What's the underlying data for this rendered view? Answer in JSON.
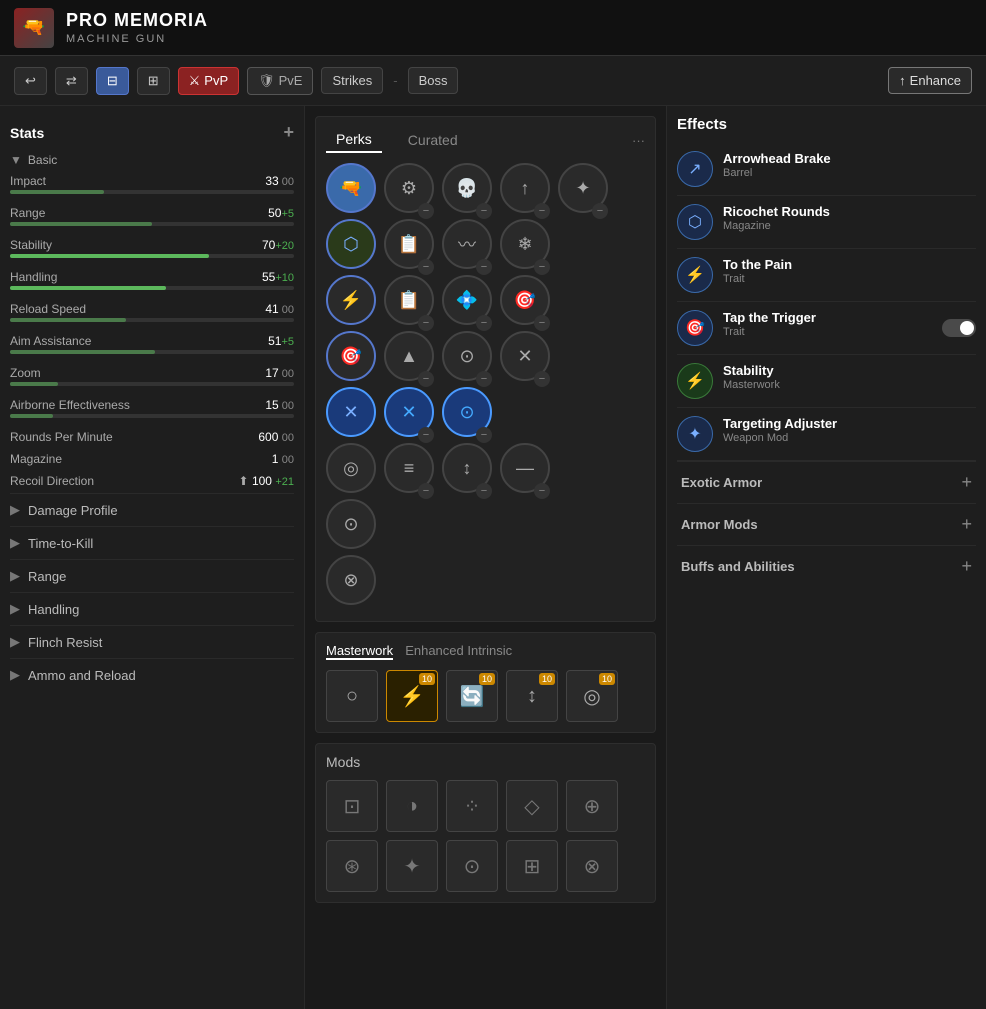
{
  "header": {
    "title": "PRO MEMORIA",
    "subtitle": "MACHINE GUN",
    "icon_char": "🔫"
  },
  "toolbar": {
    "undo_label": "↩",
    "shuffle_label": "⇄",
    "pvp_label": "PvP",
    "pve_label": "PvE",
    "strikes_label": "Strikes",
    "dash": "-",
    "boss_label": "Boss",
    "enhance_label": "Enhance",
    "pvp_icon": "⚔",
    "pve_icon": "🛡",
    "enhance_icon": "↑"
  },
  "stats": {
    "title": "Stats",
    "basic_label": "Basic",
    "items": [
      {
        "name": "Impact",
        "value": "33",
        "bonus": "",
        "bonus_type": "",
        "pct": 33
      },
      {
        "name": "Range",
        "value": "50",
        "bonus": "+5",
        "bonus_type": "pos",
        "pct": 50
      },
      {
        "name": "Stability",
        "value": "70",
        "bonus": "+20",
        "bonus_type": "pos",
        "pct": 70
      },
      {
        "name": "Handling",
        "value": "55",
        "bonus": "+10",
        "bonus_type": "pos",
        "pct": 55
      },
      {
        "name": "Reload Speed",
        "value": "41",
        "bonus": "",
        "bonus_type": "",
        "pct": 41
      },
      {
        "name": "Aim Assistance",
        "value": "51",
        "bonus": "+5",
        "bonus_type": "pos",
        "pct": 51
      },
      {
        "name": "Zoom",
        "value": "17",
        "bonus": "",
        "bonus_type": "",
        "pct": 17
      },
      {
        "name": "Airborne Effectiveness",
        "value": "15",
        "bonus": "",
        "bonus_type": "",
        "pct": 15
      }
    ],
    "rounds_per_minute": {
      "name": "Rounds Per Minute",
      "value": "600",
      "bonus": ""
    },
    "magazine": {
      "name": "Magazine",
      "value": "1",
      "bonus": ""
    },
    "recoil_direction": {
      "name": "Recoil Direction",
      "value": "100",
      "bonus": "+21",
      "bonus_type": "pos"
    }
  },
  "collapsible_sections": [
    {
      "id": "damage-profile",
      "label": "Damage Profile"
    },
    {
      "id": "time-to-kill",
      "label": "Time-to-Kill"
    },
    {
      "id": "range",
      "label": "Range"
    },
    {
      "id": "handling",
      "label": "Handling"
    },
    {
      "id": "flinch-resist",
      "label": "Flinch Resist"
    },
    {
      "id": "ammo-and-reload",
      "label": "Ammo and Reload"
    }
  ],
  "perks": {
    "tabs": [
      "Perks",
      "Curated"
    ],
    "active_tab": "Perks",
    "perk_rows": [
      {
        "left_icon": "🔵",
        "left_active": true,
        "options": [
          {
            "icon": "⚙",
            "active": false
          },
          {
            "icon": "💀",
            "active": false
          },
          {
            "icon": "↑",
            "active": false
          },
          {
            "icon": "✦",
            "active": false
          }
        ]
      },
      {
        "left_icon": "🔵",
        "left_active": true,
        "options": [
          {
            "icon": "📄",
            "active": false
          },
          {
            "icon": "〰",
            "active": false
          },
          {
            "icon": "❄",
            "active": false
          }
        ]
      },
      {
        "left_icon": "🔵",
        "left_active": true,
        "options": [
          {
            "icon": "📋",
            "active": false
          },
          {
            "icon": "💠",
            "active": false
          },
          {
            "icon": "🎯",
            "active": false
          }
        ]
      },
      {
        "left_icon": "🔵",
        "left_active": true,
        "options": [
          {
            "icon": "▲",
            "active": false
          },
          {
            "icon": "⊙",
            "active": false
          },
          {
            "icon": "✕",
            "active": false
          }
        ]
      },
      {
        "left_icon": "💠",
        "left_active": true,
        "options": [
          {
            "icon": "✕",
            "active": false
          },
          {
            "icon": "⊙",
            "active": false
          }
        ]
      },
      {
        "left_icon": "🔵",
        "left_active": false,
        "options": [
          {
            "icon": "≡",
            "active": false
          },
          {
            "icon": "↕",
            "active": false
          },
          {
            "icon": "—",
            "active": false
          }
        ]
      },
      {
        "left_icon": "🔵",
        "left_active": false,
        "options": []
      },
      {
        "left_icon": "🔵",
        "left_active": false,
        "options": []
      }
    ]
  },
  "masterwork": {
    "tabs": [
      "Masterwork",
      "Enhanced Intrinsic"
    ],
    "active_tab": "Masterwork",
    "icons": [
      {
        "icon": "○",
        "active": false,
        "badge": ""
      },
      {
        "icon": "⚡",
        "active": true,
        "badge": "10"
      },
      {
        "icon": "🔄",
        "active": false,
        "badge": "10"
      },
      {
        "icon": "↕",
        "active": false,
        "badge": "10"
      },
      {
        "icon": "◎",
        "active": false,
        "badge": "10"
      }
    ]
  },
  "mods": {
    "title": "Mods",
    "slots_row1": [
      {
        "icon": "⊡",
        "active": false
      },
      {
        "icon": "◑",
        "active": false
      },
      {
        "icon": "⁘",
        "active": false
      },
      {
        "icon": "◇",
        "active": false
      },
      {
        "icon": "⊕",
        "active": false
      }
    ],
    "slots_row2": [
      {
        "icon": "⊛",
        "active": false
      },
      {
        "icon": "✦",
        "active": false
      },
      {
        "icon": "⊙",
        "active": false
      },
      {
        "icon": "⊞",
        "active": false
      },
      {
        "icon": "⊗",
        "active": false
      }
    ]
  },
  "effects": {
    "title": "Effects",
    "items": [
      {
        "id": "arrowhead-brake",
        "icon": "🔫",
        "icon_type": "blue",
        "name": "Arrowhead Brake",
        "sub": "Barrel",
        "has_toggle": false
      },
      {
        "id": "ricochet-rounds",
        "icon": "⬡",
        "icon_type": "blue",
        "name": "Ricochet Rounds",
        "sub": "Magazine",
        "has_toggle": false
      },
      {
        "id": "to-the-pain",
        "icon": "⚡",
        "icon_type": "blue",
        "name": "To the Pain",
        "sub": "Trait",
        "has_toggle": false
      },
      {
        "id": "tap-the-trigger",
        "icon": "🎯",
        "icon_type": "blue",
        "name": "Tap the Trigger",
        "sub": "Trait",
        "has_toggle": true,
        "toggle_on": true
      },
      {
        "id": "stability-mw",
        "icon": "⚡",
        "icon_type": "green",
        "name": "Stability",
        "sub": "Masterwork",
        "has_toggle": false
      },
      {
        "id": "targeting-adjuster",
        "icon": "✦",
        "icon_type": "blue",
        "name": "Targeting Adjuster",
        "sub": "Weapon Mod",
        "has_toggle": false
      }
    ],
    "expandable": [
      {
        "id": "exotic-armor",
        "label": "Exotic Armor"
      },
      {
        "id": "armor-mods",
        "label": "Armor Mods"
      },
      {
        "id": "buffs-abilities",
        "label": "Buffs and Abilities"
      }
    ]
  }
}
